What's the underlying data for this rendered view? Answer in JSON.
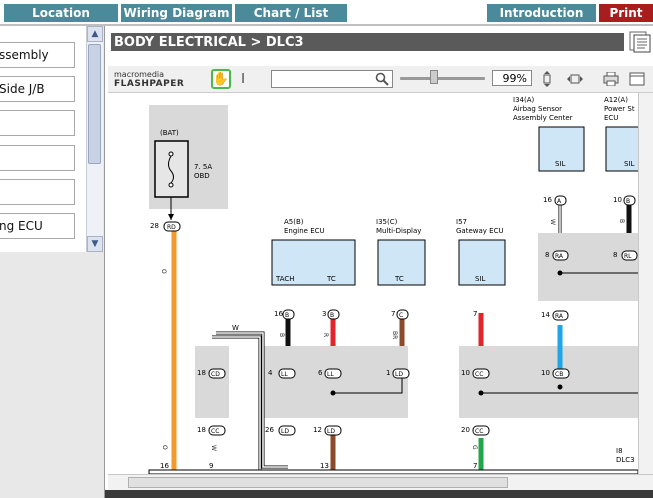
{
  "nav": {
    "tabs": [
      {
        "label": "Location"
      },
      {
        "label": "Wiring Diagram"
      },
      {
        "label": "Chart / List"
      },
      {
        "label": "Introduction"
      },
      {
        "label": "Print"
      }
    ]
  },
  "sidebar": {
    "items": [
      {
        "label": "ssembly"
      },
      {
        "label": "Side J/B"
      },
      {
        "label": ""
      },
      {
        "label": ""
      },
      {
        "label": ""
      },
      {
        "label": "ng ECU"
      }
    ]
  },
  "header": {
    "title": "BODY ELECTRICAL > DLC3"
  },
  "toolbar": {
    "logo_line1": "macromedia",
    "logo_line2": "FLASHPAPER",
    "search_value": "",
    "zoom": "99%"
  },
  "diagram": {
    "bat": "(BAT)",
    "fuse_rating": "7. 5A",
    "fuse_name": "OBD",
    "components": [
      {
        "code": "A5(B)",
        "name": "Engine ECU",
        "pins": [
          "TACH",
          "TC"
        ]
      },
      {
        "code": "I35(C)",
        "name": "Multi-Display",
        "pins": [
          "TC"
        ]
      },
      {
        "code": "I57",
        "name": "Gateway ECU",
        "pins": [
          "SIL"
        ]
      },
      {
        "code": "I34(A)",
        "name_line1": "Airbag Sensor",
        "name_line2": "Assembly Center",
        "pins": [
          "SIL"
        ]
      },
      {
        "code": "A12(A)",
        "name_line1": "Power St",
        "name_line2": "ECU",
        "pins": [
          "SIL"
        ]
      }
    ],
    "connector": {
      "code": "I8",
      "name": "DLC3"
    },
    "wire_w": "W",
    "pin_numbers": [
      "28",
      "16",
      "3",
      "7",
      "7",
      "16",
      "10",
      "8",
      "8",
      "14",
      "18",
      "18",
      "4",
      "6",
      "1",
      "10",
      "10",
      "26",
      "12",
      "20",
      "16",
      "9",
      "13",
      "7"
    ],
    "pin_labels": [
      "RD",
      "B",
      "B",
      "C",
      "A",
      "B",
      "RA",
      "RL",
      "RA",
      "CD",
      "CC",
      "LL",
      "LL",
      "LD",
      "CC",
      "CB",
      "LD",
      "LD",
      "CC"
    ],
    "wire_letters": [
      "O",
      "B",
      "R",
      "BR",
      "W",
      "B",
      "O",
      "W",
      "G"
    ]
  }
}
